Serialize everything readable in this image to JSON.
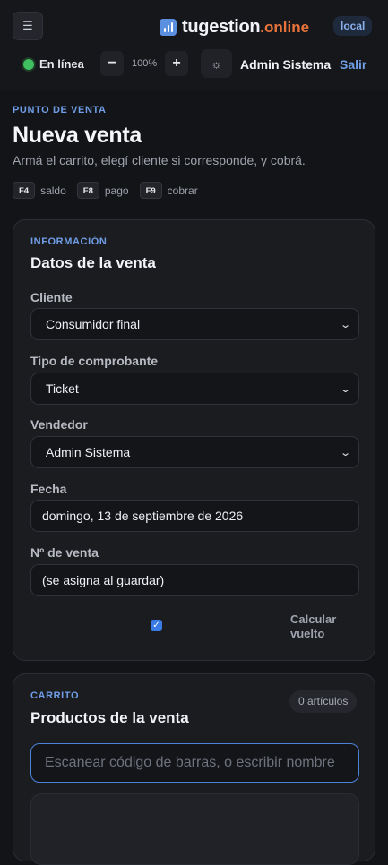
{
  "header": {
    "brand": {
      "name": "tugestion",
      "tld": ".online"
    },
    "env_badge": "local",
    "status_label": "En línea",
    "zoom": {
      "minus": "−",
      "value": "100%",
      "plus": "+"
    },
    "user_name": "Admin Sistema",
    "logout_label": "Salir",
    "icons": {
      "menu": "menu-icon",
      "theme": "sun-icon",
      "logo": "bar-chart-icon"
    },
    "colors": {
      "accent": "#6f9de6",
      "brand_tld": "#e8743b",
      "online": "#3fbf5f"
    }
  },
  "page": {
    "eyebrow": "PUNTO DE VENTA",
    "title": "Nueva venta",
    "subtitle": "Armá el carrito, elegí cliente si corresponde, y cobrá.",
    "shortcuts": [
      {
        "key": "F4",
        "label": "saldo"
      },
      {
        "key": "F8",
        "label": "pago"
      },
      {
        "key": "F9",
        "label": "cobrar"
      }
    ]
  },
  "sale_info": {
    "eyebrow": "INFORMACIÓN",
    "title": "Datos de la venta",
    "client": {
      "label": "Cliente",
      "value": "Consumidor final"
    },
    "voucher_type": {
      "label": "Tipo de comprobante",
      "value": "Ticket"
    },
    "seller": {
      "label": "Vendedor",
      "value": "Admin Sistema"
    },
    "date": {
      "label": "Fecha",
      "value": "domingo, 13 de septiembre de 2026"
    },
    "sale_number": {
      "label": "Nº de venta",
      "value": "(se asigna al guardar)"
    },
    "calc_change": {
      "label": "Calcular vuelto",
      "checked": true
    }
  },
  "cart": {
    "eyebrow": "CARRITO",
    "title": "Productos de la venta",
    "count_badge": "0 artículos",
    "scan_placeholder": "Escanear código de barras, o escribir nombre"
  }
}
